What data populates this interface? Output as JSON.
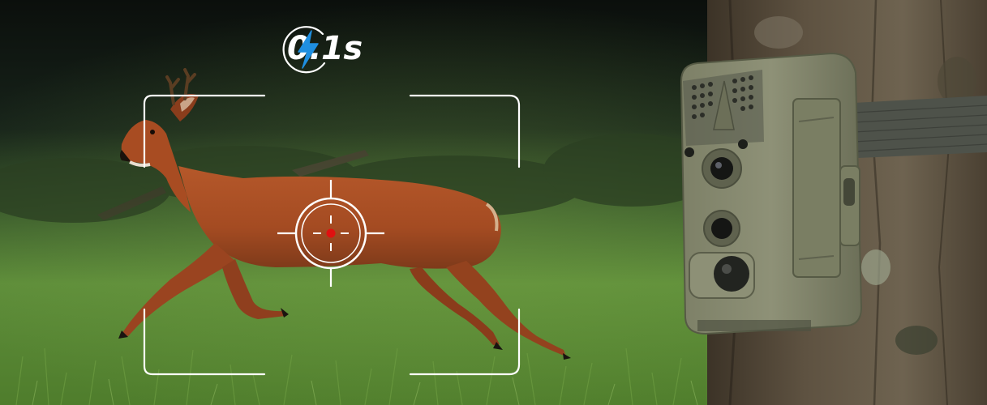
{
  "badge": {
    "value": "0.1s",
    "icon": "lightning-bolt-icon",
    "icon_color": "#1f8fe0"
  },
  "reticle": {
    "icon": "crosshair-target-icon",
    "center_color": "#e01010"
  },
  "scene": {
    "subjects": [
      "running-deer",
      "trail-camera",
      "tree-trunk",
      "grass-field"
    ]
  }
}
